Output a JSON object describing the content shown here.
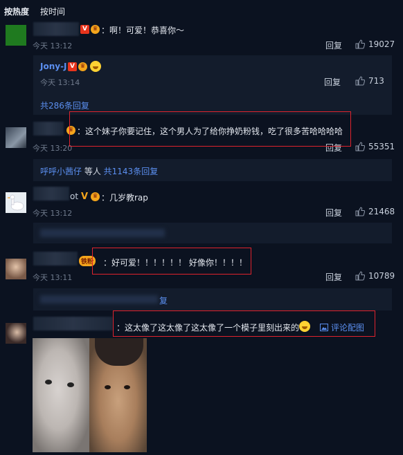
{
  "sort": {
    "hot": "按热度",
    "time": "按时间"
  },
  "comments": [
    {
      "text": "：啊！可爱！恭喜你～",
      "time": "今天 13:12",
      "reply": "回复",
      "likes": "19027",
      "sub": {
        "name": "Jony-J",
        "time": "今天 13:14",
        "reply": "回复",
        "likes": "713",
        "more": "共286条回复"
      }
    },
    {
      "text": "：这个妹子你要记住，这个男人为了给你挣奶粉钱，吃了很多苦哈哈哈哈",
      "time": "今天 13:20",
      "reply": "回复",
      "likes": "55351",
      "sub_name": "呼呼小茜仔",
      "sub_mid": " 等人 ",
      "sub_more": "共1143条回复"
    },
    {
      "name_tail": "ot",
      "text": "：几岁教rap",
      "time": "今天 13:12",
      "reply": "回复",
      "likes": "21468"
    },
    {
      "badge_label": "铁粉",
      "text": "：好可爱！！！！！！ 好像你！！！！",
      "time": "今天 13:11",
      "reply": "回复",
      "likes": "10789",
      "sub_tail": "复"
    },
    {
      "text": "：这太像了这太像了这太像了一个模子里刻出来的",
      "pic_link": "评论配图"
    }
  ],
  "colors": {
    "accent": "#5b8ff0",
    "highlight": "#e0232d",
    "background": "#0b1220"
  },
  "icons": [
    "thumb-up-icon",
    "image-icon",
    "vip-badge-icon",
    "crown-badge-icon",
    "grin-emoji-icon",
    "scream-emoji-icon"
  ]
}
